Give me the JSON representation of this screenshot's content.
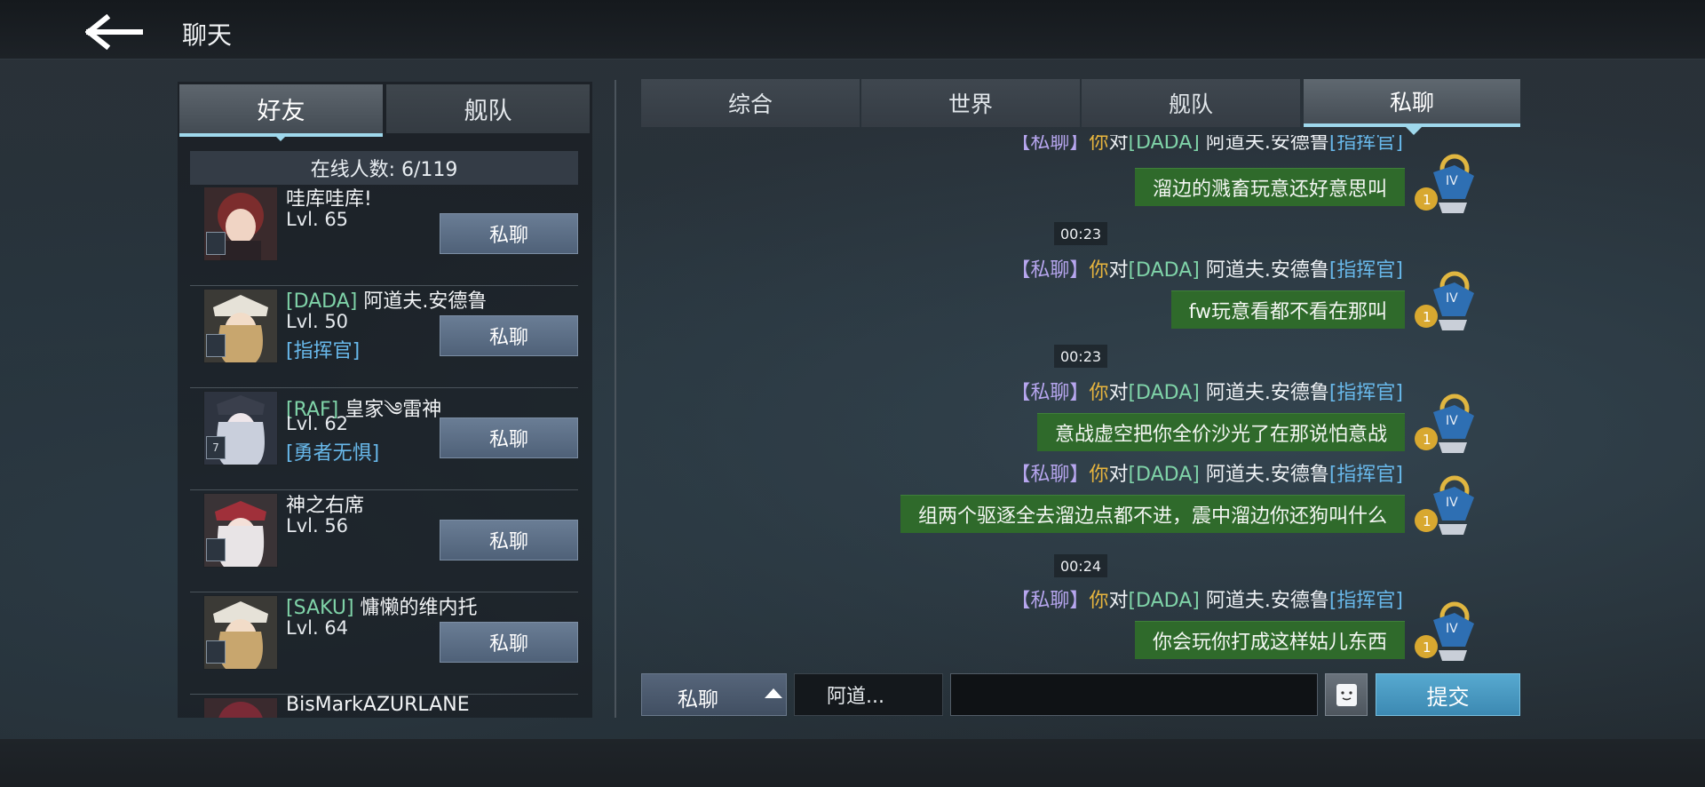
{
  "header": {
    "title": "聊天"
  },
  "friends_panel": {
    "tabs": [
      {
        "label": "好友",
        "active": true
      },
      {
        "label": "舰队",
        "active": false
      }
    ],
    "online_count": "在线人数: 6/119",
    "friends": [
      {
        "name": "哇库哇库!",
        "tag": "",
        "level": "Lvl. 65",
        "title": "",
        "button": "私聊",
        "avatar_color": "#8a3a3a"
      },
      {
        "name": "阿道夫.安德鲁",
        "tag": "[DADA]",
        "level": "Lvl. 50",
        "title": "[指挥官]",
        "button": "私聊",
        "avatar_color": "#b59a6e"
      },
      {
        "name": "皇家༄雷神",
        "tag": "[RAF]",
        "level": "Lvl. 62",
        "title": "[勇者无惧]",
        "button": "私聊",
        "avatar_color": "#9aa3b8"
      },
      {
        "name": "神之右席",
        "tag": "",
        "level": "Lvl. 56",
        "title": "",
        "button": "私聊",
        "avatar_color": "#c8c4c6"
      },
      {
        "name": "慵懒的维内托",
        "tag": "[SAKU]",
        "level": "Lvl. 64",
        "title": "",
        "button": "私聊",
        "avatar_color": "#b59a6e"
      },
      {
        "name": "BisMarkAZURLANE",
        "tag": "",
        "level": "",
        "title": "",
        "button": "",
        "avatar_color": "#8a3a4a"
      }
    ]
  },
  "chat_tabs": [
    {
      "label": "综合",
      "active": false
    },
    {
      "label": "世界",
      "active": false
    },
    {
      "label": "舰队",
      "active": false
    },
    {
      "label": "私聊",
      "active": true
    }
  ],
  "messages": {
    "m1": {
      "channel": "【私聊】",
      "you": "你",
      "to": "对",
      "tag": "[DADA]",
      "target": " 阿道夫.安德鲁",
      "rank": "[指挥官]",
      "text": "溜边的溅畜玩意还好意思叫"
    },
    "t1": "00:23",
    "m2": {
      "channel": "【私聊】",
      "you": "你",
      "to": "对",
      "tag": "[DADA]",
      "target": " 阿道夫.安德鲁",
      "rank": "[指挥官]",
      "text": "fw玩意看都不看在那叫"
    },
    "t2": "00:23",
    "m3": {
      "channel": "【私聊】",
      "you": "你",
      "to": "对",
      "tag": "[DADA]",
      "target": " 阿道夫.安德鲁",
      "rank": "[指挥官]",
      "text": "意战虚空把你全价沙光了在那说怕意战"
    },
    "m4": {
      "channel": "【私聊】",
      "you": "你",
      "to": "对",
      "tag": "[DADA]",
      "target": " 阿道夫.安德鲁",
      "rank": "[指挥官]",
      "text": "组两个驱逐全去溜边点都不进，震中溜边你还狗叫什么"
    },
    "t3": "00:24",
    "m5": {
      "channel": "【私聊】",
      "you": "你",
      "to": "对",
      "tag": "[DADA]",
      "target": " 阿道夫.安德鲁",
      "rank": "[指挥官]",
      "text": "你会玩你打成这样姑儿东西"
    }
  },
  "input_bar": {
    "channel": "私聊",
    "target": "阿道...",
    "message_placeholder": "",
    "submit": "提交"
  },
  "colors": {
    "bubble": "#2f6a2b",
    "accent": "#9fd8ec",
    "submit": "#4a9bc4",
    "tag": "#7fd3a8",
    "rank": "#68b8ea",
    "you": "#e9b63e",
    "channel": "#b7a6ef"
  }
}
